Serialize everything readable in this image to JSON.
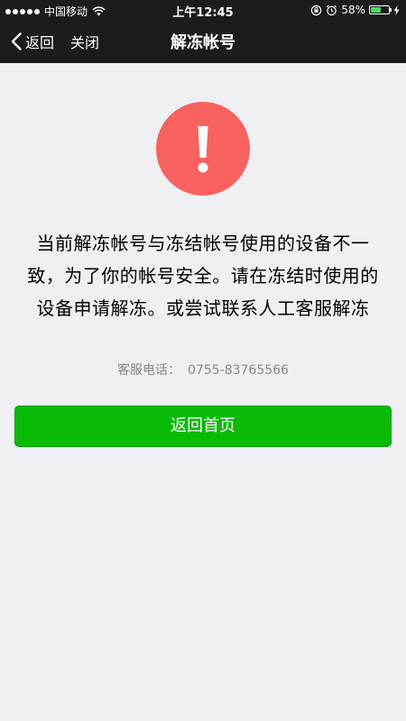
{
  "status_bar": {
    "carrier": "中国移动",
    "time": "上午12:45",
    "battery_percent": "58%",
    "battery_level": 0.58,
    "icons": [
      "signal-dots",
      "wifi-icon",
      "rotation-lock-icon",
      "alarm-icon",
      "battery-icon",
      "charging-bolt-icon"
    ]
  },
  "nav": {
    "back_label": "返回",
    "close_label": "关闭",
    "title": "解冻帐号"
  },
  "alert": {
    "icon": "warning-icon",
    "color": "#f76260",
    "message": "当前解冻帐号与冻结帐号使用的设备不一致，为了你的帐号安全。请在冻结时使用的设备申请解冻。或尝试联系人工客服解冻",
    "hotline_label": "客服电话：",
    "hotline_number": "0755-83765566"
  },
  "actions": {
    "home_label": "返回首页",
    "home_color": "#09bb07"
  }
}
